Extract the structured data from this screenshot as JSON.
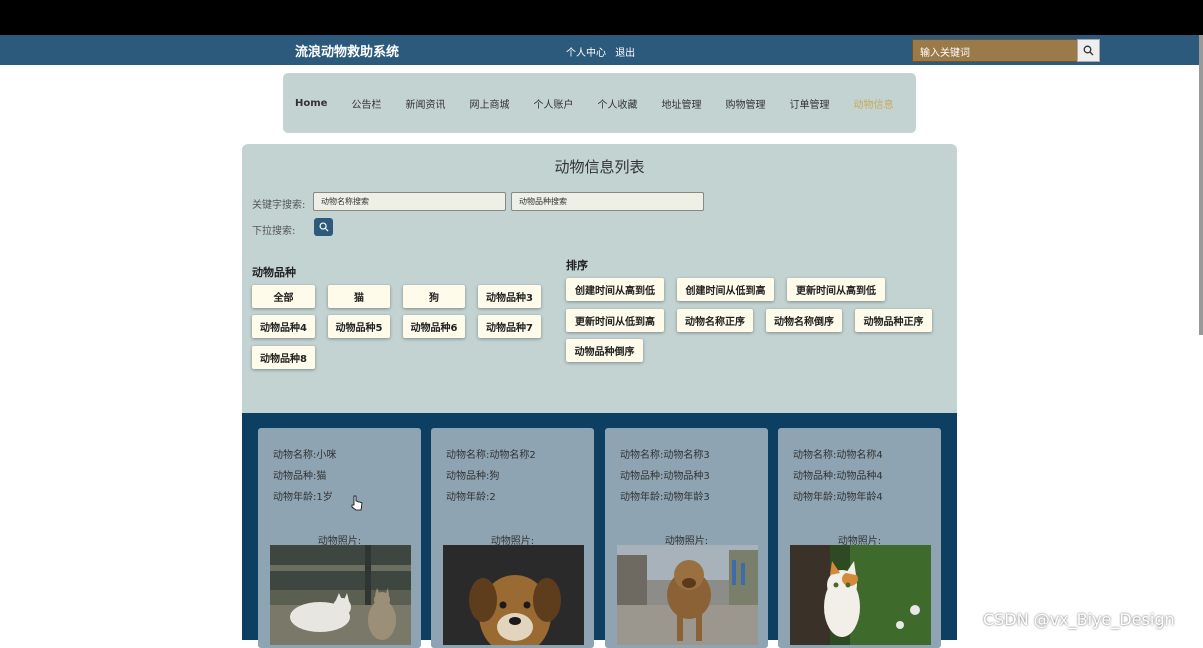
{
  "header": {
    "site_title": "流浪动物救助系统",
    "user_center": "个人中心",
    "logout": "退出",
    "search_placeholder": "输入关键词"
  },
  "nav": {
    "items": [
      "Home",
      "公告栏",
      "新闻资讯",
      "网上商城",
      "个人账户",
      "个人收藏",
      "地址管理",
      "购物管理",
      "订单管理",
      "动物信息"
    ],
    "active": "动物信息"
  },
  "panel": {
    "title": "动物信息列表",
    "keyword_label": "关键字搜索:",
    "name_placeholder": "动物名称搜索",
    "breed_placeholder": "动物品种搜索",
    "dropdown_label": "下拉搜索:"
  },
  "breed_filter": {
    "title": "动物品种",
    "options": [
      "全部",
      "猫",
      "狗",
      "动物品种3",
      "动物品种4",
      "动物品种5",
      "动物品种6",
      "动物品种7",
      "动物品种8"
    ]
  },
  "sort": {
    "title": "排序",
    "options": [
      "创建时间从高到低",
      "创建时间从低到高",
      "更新时间从高到低",
      "更新时间从低到高",
      "动物名称正序",
      "动物名称倒序",
      "动物品种正序",
      "动物品种倒序"
    ]
  },
  "cards": [
    {
      "name": "动物名称:小咪",
      "breed": "动物品种:猫",
      "age": "动物年龄:1岁",
      "photo_label": "动物照片:"
    },
    {
      "name": "动物名称:动物名称2",
      "breed": "动物品种:狗",
      "age": "动物年龄:2",
      "photo_label": "动物照片:"
    },
    {
      "name": "动物名称:动物名称3",
      "breed": "动物品种:动物品种3",
      "age": "动物年龄:动物年龄3",
      "photo_label": "动物照片:"
    },
    {
      "name": "动物名称:动物名称4",
      "breed": "动物品种:动物品种4",
      "age": "动物年龄:动物年龄4",
      "photo_label": "动物照片:"
    }
  ],
  "watermark": "CSDN @vx_Biye_Design"
}
